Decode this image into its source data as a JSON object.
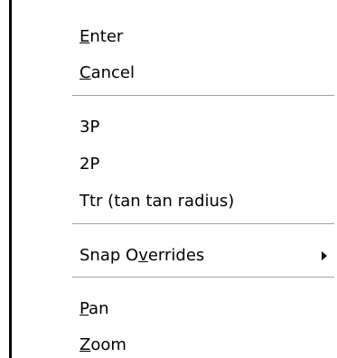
{
  "menu": {
    "items": [
      {
        "pre": "",
        "mnemonic": "E",
        "post": "nter"
      },
      {
        "pre": "",
        "mnemonic": "C",
        "post": "ancel"
      },
      {
        "pre": "3P",
        "mnemonic": "",
        "post": ""
      },
      {
        "pre": "2P",
        "mnemonic": "",
        "post": ""
      },
      {
        "pre": "Ttr (tan tan radius)",
        "mnemonic": "",
        "post": ""
      },
      {
        "pre": "Snap O",
        "mnemonic": "v",
        "post": "errides"
      },
      {
        "pre": "",
        "mnemonic": "P",
        "post": "an"
      },
      {
        "pre": "",
        "mnemonic": "Z",
        "post": "oom"
      }
    ]
  },
  "icons": {
    "cursor": "arrow-cursor-icon",
    "submenu": "submenu-arrow-icon"
  },
  "colors": {
    "background": "#ffffff",
    "text": "#000000",
    "separator": "#a0a0a0"
  }
}
